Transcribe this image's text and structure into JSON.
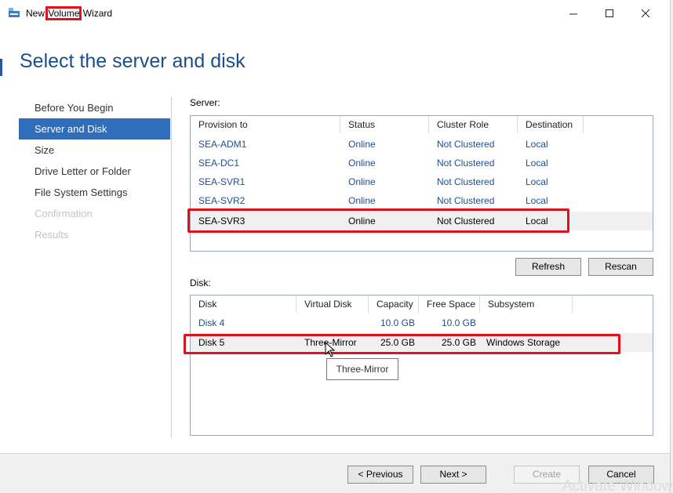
{
  "window": {
    "title_before": "New ",
    "title_highlight": "Volume",
    "title_after": " Wizard",
    "minimize_icon": "minimize-icon",
    "maximize_icon": "maximize-icon",
    "close_icon": "close-icon"
  },
  "heading": "Select the server and disk",
  "steps": [
    {
      "label": "Before You Begin",
      "state": "normal"
    },
    {
      "label": "Server and Disk",
      "state": "active"
    },
    {
      "label": "Size",
      "state": "normal"
    },
    {
      "label": "Drive Letter or Folder",
      "state": "normal"
    },
    {
      "label": "File System Settings",
      "state": "normal"
    },
    {
      "label": "Confirmation",
      "state": "disabled"
    },
    {
      "label": "Results",
      "state": "disabled"
    }
  ],
  "server": {
    "label": "Server:",
    "columns": [
      "Provision to",
      "Status",
      "Cluster Role",
      "Destination"
    ],
    "rows": [
      [
        "SEA-ADM1",
        "Online",
        "Not Clustered",
        "Local"
      ],
      [
        "SEA-DC1",
        "Online",
        "Not Clustered",
        "Local"
      ],
      [
        "SEA-SVR1",
        "Online",
        "Not Clustered",
        "Local"
      ],
      [
        "SEA-SVR2",
        "Online",
        "Not Clustered",
        "Local"
      ],
      [
        "SEA-SVR3",
        "Online",
        "Not Clustered",
        "Local"
      ]
    ],
    "selected_row": 4,
    "refresh_label": "Refresh",
    "rescan_label": "Rescan"
  },
  "disk": {
    "label": "Disk:",
    "columns": [
      "Disk",
      "Virtual Disk",
      "Capacity",
      "Free Space",
      "Subsystem"
    ],
    "rows": [
      [
        "Disk 4",
        "",
        "10.0 GB",
        "10.0 GB",
        ""
      ],
      [
        "Disk 5",
        "Three-Mirror",
        "25.0 GB",
        "25.0 GB",
        "Windows Storage"
      ]
    ],
    "selected_row": 1,
    "tooltip": "Three-Mirror"
  },
  "footer": {
    "previous_label": "< Previous",
    "next_label": "Next >",
    "create_label": "Create",
    "cancel_label": "Cancel",
    "watermark": "Activate Windows"
  },
  "colors": {
    "accent": "#2f6eba",
    "heading": "#1a4f8b",
    "link_text": "#1f4e8c",
    "highlight_box": "#e0101c"
  }
}
